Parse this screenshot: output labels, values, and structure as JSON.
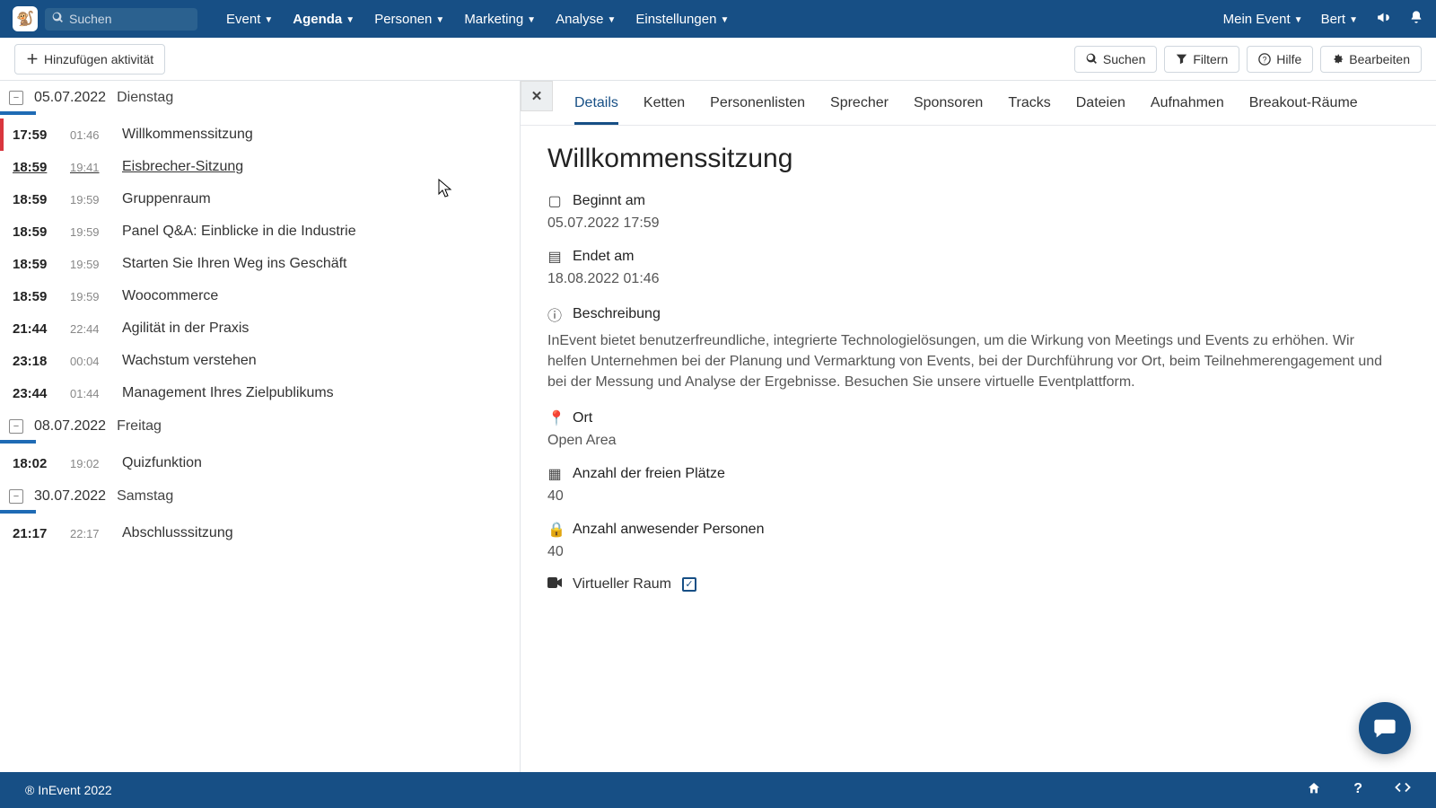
{
  "topnav": {
    "search_placeholder": "Suchen",
    "items": [
      "Event",
      "Agenda",
      "Personen",
      "Marketing",
      "Analyse",
      "Einstellungen"
    ],
    "active_index": 1,
    "right_items": [
      "Mein Event",
      "Bert"
    ]
  },
  "toolbar": {
    "add_label": "Hinzufügen aktivität",
    "search_label": "Suchen",
    "filter_label": "Filtern",
    "help_label": "Hilfe",
    "edit_label": "Bearbeiten"
  },
  "agenda": {
    "days": [
      {
        "date": "05.07.2022",
        "dayname": "Dienstag",
        "sessions": [
          {
            "start": "17:59",
            "end": "01:46",
            "title": "Willkommenssitzung",
            "active": true
          },
          {
            "start": "18:59",
            "end": "19:41",
            "title": "Eisbrecher-Sitzung",
            "hover": true
          },
          {
            "start": "18:59",
            "end": "19:59",
            "title": "Gruppenraum"
          },
          {
            "start": "18:59",
            "end": "19:59",
            "title": "Panel Q&A: Einblicke in die Industrie"
          },
          {
            "start": "18:59",
            "end": "19:59",
            "title": "Starten Sie Ihren Weg ins Geschäft"
          },
          {
            "start": "18:59",
            "end": "19:59",
            "title": "Woocommerce"
          },
          {
            "start": "21:44",
            "end": "22:44",
            "title": "Agilität in der Praxis"
          },
          {
            "start": "23:18",
            "end": "00:04",
            "title": "Wachstum verstehen"
          },
          {
            "start": "23:44",
            "end": "01:44",
            "title": "Management Ihres Zielpublikums"
          }
        ]
      },
      {
        "date": "08.07.2022",
        "dayname": "Freitag",
        "sessions": [
          {
            "start": "18:02",
            "end": "19:02",
            "title": "Quizfunktion"
          }
        ]
      },
      {
        "date": "30.07.2022",
        "dayname": "Samstag",
        "sessions": [
          {
            "start": "21:17",
            "end": "22:17",
            "title": "Abschlusssitzung"
          }
        ]
      }
    ]
  },
  "detail": {
    "tabs": [
      "Details",
      "Ketten",
      "Personenlisten",
      "Sprecher",
      "Sponsoren",
      "Tracks",
      "Dateien",
      "Aufnahmen",
      "Breakout-Räume"
    ],
    "active_tab": 0,
    "title": "Willkommenssitzung",
    "fields": {
      "starts_label": "Beginnt am",
      "starts_value": "05.07.2022 17:59",
      "ends_label": "Endet am",
      "ends_value": "18.08.2022 01:46",
      "desc_label": "Beschreibung",
      "desc_value": "InEvent bietet benutzerfreundliche, integrierte Technologielösungen, um die Wirkung von Meetings und Events zu erhöhen. Wir helfen Unternehmen bei der Planung und Vermarktung von Events, bei der Durchführung vor Ort, beim Teilnehmerengagement und bei der Messung und Analyse der Ergebnisse. Besuchen Sie unsere virtuelle Eventplattform.",
      "place_label": "Ort",
      "place_value": "Open Area",
      "seats_label": "Anzahl der freien Plätze",
      "seats_value": "40",
      "attendees_label": "Anzahl anwesender Personen",
      "attendees_value": "40",
      "virtual_label": "Virtueller Raum"
    }
  },
  "footer": {
    "copyright": "® InEvent 2022"
  }
}
